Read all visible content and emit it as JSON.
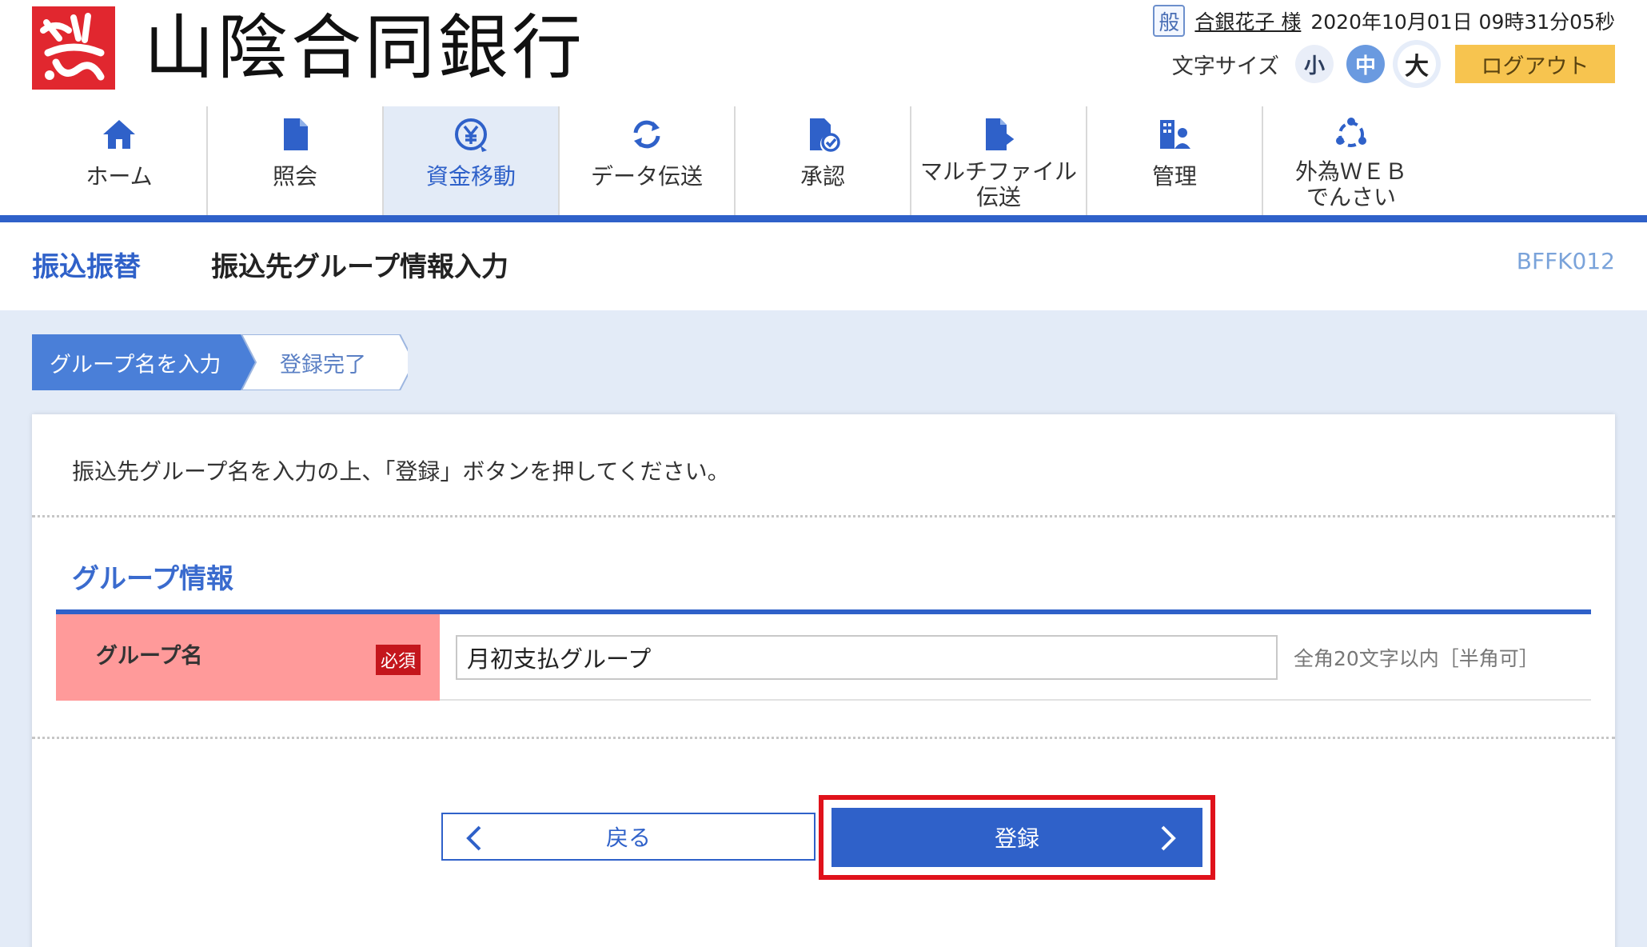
{
  "header": {
    "bank_name": "山陰合同銀行",
    "user_badge": "般",
    "user_name": "合銀花子 様",
    "datetime": "2020年10月01日 09時31分05秒",
    "font_size_label": "文字サイズ",
    "font_sizes": [
      "小",
      "中",
      "大"
    ],
    "font_size_selected": "中",
    "logout_label": "ログアウト"
  },
  "nav": {
    "items": [
      {
        "label": "ホーム",
        "icon": "home-icon"
      },
      {
        "label": "照会",
        "icon": "document-icon"
      },
      {
        "label": "資金移動",
        "icon": "yen-transfer-icon",
        "active": true
      },
      {
        "label": "データ伝送",
        "icon": "sync-icon"
      },
      {
        "label": "承認",
        "icon": "approval-icon"
      },
      {
        "label": "マルチファイル\n伝送",
        "icon": "file-transfer-icon"
      },
      {
        "label": "管理",
        "icon": "management-icon"
      },
      {
        "label": "外為ＷＥＢ\nでんさい",
        "icon": "network-icon"
      }
    ]
  },
  "page": {
    "section": "振込振替",
    "title": "振込先グループ情報入力",
    "screen_id": "BFFK012"
  },
  "steps": [
    "グループ名を入力",
    "登録完了"
  ],
  "current_step": 1,
  "instruction": "振込先グループ名を入力の上、「登録」ボタンを押してください。",
  "form": {
    "section_title": "グループ情報",
    "field_label": "グループ名",
    "required_label": "必須",
    "group_name_value": "月初支払グループ",
    "hint": "全角20文字以内［半角可］"
  },
  "buttons": {
    "back_label": "戻る",
    "register_label": "登録"
  },
  "colors": {
    "brand_blue": "#2f61c9",
    "logo_red": "#e1272f",
    "required_red": "#c4161c",
    "highlight_red": "#e0121b",
    "logout_yellow": "#f7c44f"
  }
}
